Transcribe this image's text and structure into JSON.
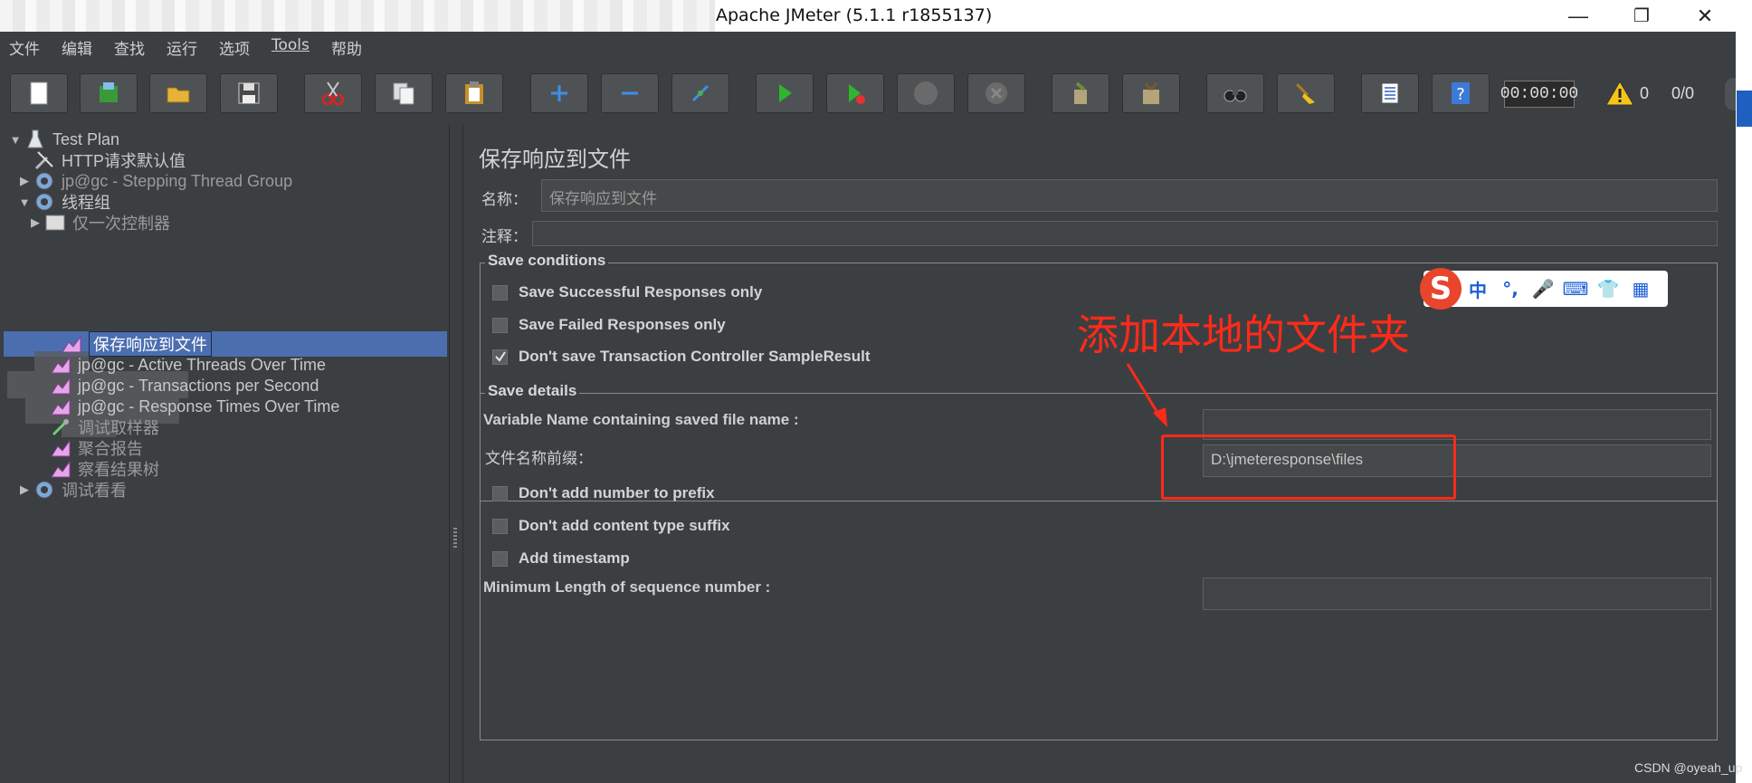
{
  "window": {
    "title": "Apache JMeter (5.1.1 r1855137)",
    "minimize_glyph": "—",
    "restore_glyph": "❐",
    "close_glyph": "✕"
  },
  "menu": {
    "items": [
      "文件",
      "编辑",
      "查找",
      "运行",
      "选项",
      "Tools",
      "帮助"
    ]
  },
  "toolbar": {
    "buttons": [
      {
        "name": "new-icon"
      },
      {
        "name": "templates-icon"
      },
      {
        "name": "open-icon"
      },
      {
        "name": "save-icon"
      },
      {
        "name": "cut-icon"
      },
      {
        "name": "copy-icon"
      },
      {
        "name": "paste-icon"
      },
      {
        "name": "expand-icon"
      },
      {
        "name": "collapse-icon"
      },
      {
        "name": "toggle-icon"
      },
      {
        "name": "start-icon"
      },
      {
        "name": "start-no-pauses-icon"
      },
      {
        "name": "stop-icon"
      },
      {
        "name": "shutdown-icon"
      },
      {
        "name": "clear-icon"
      },
      {
        "name": "clear-all-icon"
      },
      {
        "name": "search-icon"
      },
      {
        "name": "reset-search-icon"
      },
      {
        "name": "function-helper-icon"
      },
      {
        "name": "help-icon"
      }
    ],
    "timer": "00:00:00",
    "warning_count": "0",
    "thread_ratio": "0/0"
  },
  "tree": {
    "nodes": [
      {
        "label": "Test Plan"
      },
      {
        "label": "HTTP请求默认值"
      },
      {
        "label": "jp@gc - Stepping Thread Group"
      },
      {
        "label": "线程组"
      },
      {
        "label": "仅一次控制器"
      },
      {
        "label": "保存响应到文件"
      },
      {
        "label": "jp@gc - Active Threads Over Time"
      },
      {
        "label": "jp@gc - Transactions per Second"
      },
      {
        "label": "jp@gc - Response Times Over Time"
      },
      {
        "label": "调试取样器"
      },
      {
        "label": "聚合报告"
      },
      {
        "label": "察看结果树"
      },
      {
        "label": "调试看看"
      }
    ]
  },
  "panel": {
    "title": "保存响应到文件",
    "name_label": "名称：",
    "name_value": "保存响应到文件",
    "comment_label": "注释：",
    "comment_value": "",
    "save_conditions": {
      "legend": "Save conditions",
      "options": [
        {
          "label": "Save Successful Responses only",
          "checked": false
        },
        {
          "label": "Save Failed Responses only",
          "checked": false
        },
        {
          "label": "Don't save Transaction Controller SampleResult",
          "checked": true
        }
      ]
    },
    "save_details": {
      "legend": "Save details",
      "var_name_label": "Variable Name containing saved file name :",
      "var_name_value": "",
      "prefix_label": "文件名称前缀：",
      "prefix_value": "D:\\jmeteresponse\\files",
      "options": [
        {
          "label": "Don't add number to prefix",
          "checked": false
        },
        {
          "label": "Don't add content type suffix",
          "checked": false
        },
        {
          "label": "Add timestamp",
          "checked": false
        }
      ],
      "min_length_label": "Minimum Length of sequence number :",
      "min_length_value": ""
    }
  },
  "ime": {
    "logo": "S",
    "items": [
      "中",
      "°,",
      "🎤",
      "⌨",
      "👕",
      "▦"
    ]
  },
  "annotation": {
    "text": "添加本地的文件夹",
    "color": "#ff2a1a"
  },
  "watermark": "CSDN @oyeah_up"
}
